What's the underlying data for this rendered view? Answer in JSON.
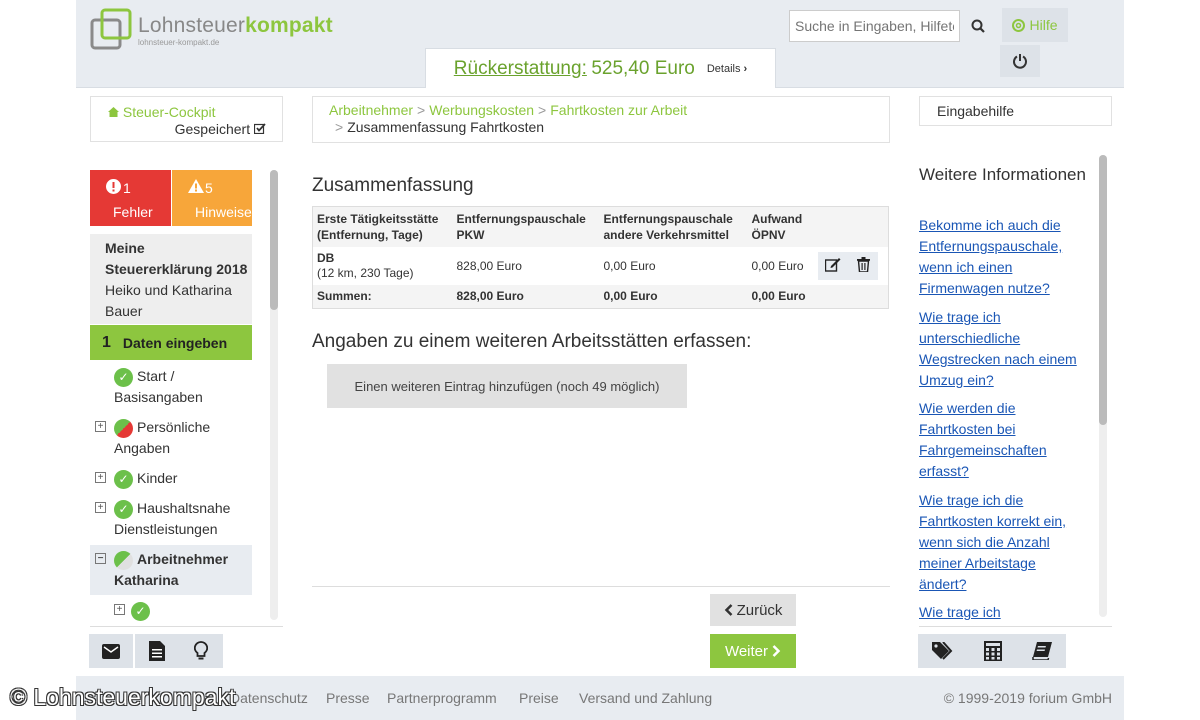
{
  "header": {
    "logo_name": "Lohnsteuer",
    "logo_name_bold": "kompakt",
    "logo_sub": "lohnsteuer-kompakt.de",
    "search_placeholder": "Suche in Eingaben, Hilfetexten",
    "help_label": "Hilfe",
    "refund_label": "Rückerstattung:",
    "refund_value": "525,40 Euro",
    "details_label": "Details"
  },
  "left": {
    "cockpit_label": "Steuer-Cockpit",
    "saved_label": "Gespeichert",
    "errors_count": "1",
    "errors_label": "Fehler",
    "hints_count": "5",
    "hints_label": "Hinweise",
    "declaration_title": "Meine Steuererklärung 2018",
    "declaration_names": "Heiko und Katharina Bauer",
    "step_number": "1",
    "step_label": "Daten eingeben",
    "nav": [
      {
        "line1": "Start /",
        "line2": "Basisangaben"
      },
      {
        "line1": "Persönliche",
        "line2": "Angaben"
      },
      {
        "line1": "Kinder",
        "line2": ""
      },
      {
        "line1": "Haushaltsnahe",
        "line2": "Dienstleistungen"
      },
      {
        "line1": "Arbeitnehmer",
        "line2": "Katharina"
      }
    ]
  },
  "breadcrumb": {
    "items": [
      "Arbeitnehmer",
      "Werbungskosten",
      "Fahrtkosten zur Arbeit"
    ],
    "current": "Zusammenfassung Fahrtkosten",
    "separator": ">"
  },
  "main": {
    "summary_title": "Zusammenfassung",
    "columns": [
      {
        "line1": "Erste Tätigkeitsstätte",
        "line2": "(Entfernung, Tage)"
      },
      {
        "line1": "Entfernungspauschale",
        "line2": "PKW"
      },
      {
        "line1": "Entfernungspauschale",
        "line2": "andere Verkehrsmittel"
      },
      {
        "line1": "Aufwand",
        "line2": "ÖPNV"
      }
    ],
    "row": {
      "name": "DB",
      "detail": "(12 km, 230 Tage)",
      "pkw": "828,00 Euro",
      "other": "0,00 Euro",
      "oepnv": "0,00 Euro"
    },
    "sums": {
      "label": "Summen:",
      "pkw": "828,00 Euro",
      "other": "0,00 Euro",
      "oepnv": "0,00 Euro"
    },
    "add_title": "Angaben zu einem weiteren Arbeitsstätten erfassen:",
    "add_button": "Einen weiteren Eintrag hinzufügen (noch 49 möglich)",
    "back_button": "Zurück",
    "next_button": "Weiter"
  },
  "right": {
    "eingabehilfe_label": "Eingabehilfe",
    "more_title": "Weitere Informationen",
    "questions": [
      "Bekomme ich auch die Entfernungspauschale, wenn ich einen Firmenwagen nutze?",
      "Wie trage ich unterschiedliche Wegstrecken nach einem Umzug ein?",
      "Wie werden die Fahrtkosten bei Fahrgemeinschaften erfasst?",
      "Wie trage ich die Fahrtkosten korrekt ein, wenn sich die Anzahl meiner Arbeitstage ändert?",
      "Wie trage ich"
    ]
  },
  "footer": {
    "links": [
      "Datenschutz",
      "Presse",
      "Partnerprogramm",
      "Preise",
      "Versand und Zahlung"
    ],
    "copyright": "© 1999-2019 forium GmbH",
    "watermark": "© Lohnsteuerkompakt"
  },
  "colors": {
    "brand_green": "#8dc63f",
    "error_red": "#e53935",
    "warning_orange": "#f7a63a",
    "link_blue": "#1a56b5"
  },
  "icons": [
    "search-icon",
    "help-circle-icon",
    "power-icon",
    "home-icon",
    "check-square-icon",
    "alert-circle-icon",
    "warning-icon",
    "edit-icon",
    "trash-icon",
    "envelope-icon",
    "document-icon",
    "lightbulb-icon",
    "tags-icon",
    "calculator-icon",
    "book-icon",
    "chevron-left-icon",
    "chevron-right-icon"
  ]
}
